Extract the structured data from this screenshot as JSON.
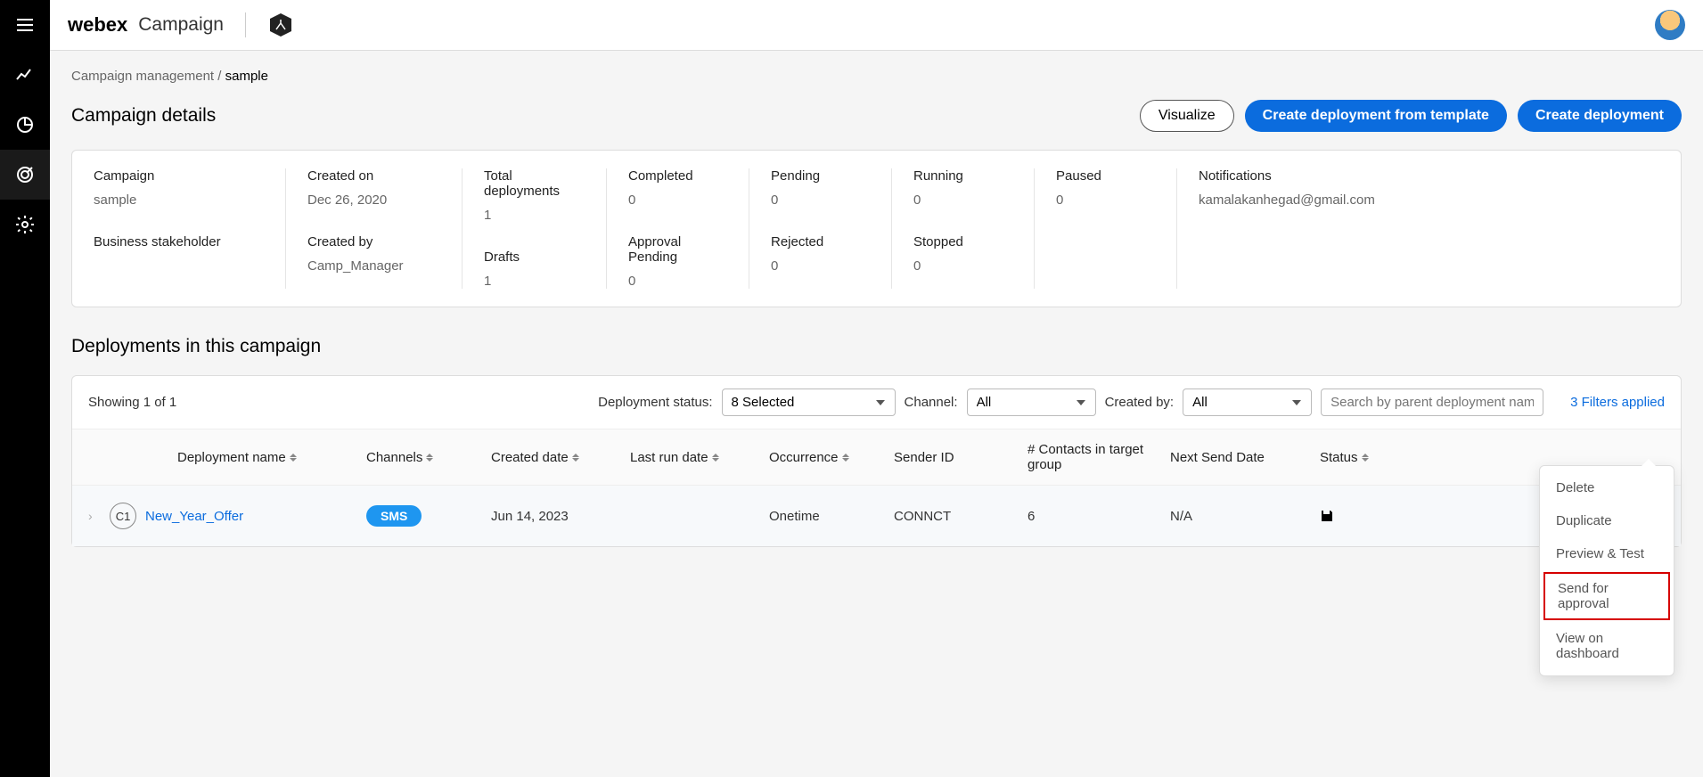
{
  "app": {
    "brand": "webex",
    "product": "Campaign"
  },
  "breadcrumb": {
    "parent": "Campaign management",
    "sep": " / ",
    "current": "sample"
  },
  "page_title": "Campaign details",
  "actions": {
    "visualize": "Visualize",
    "create_from_template": "Create deployment from template",
    "create_deployment": "Create deployment"
  },
  "details": {
    "campaign_label": "Campaign",
    "campaign_value": "sample",
    "stakeholder_label": "Business stakeholder",
    "stakeholder_value": "",
    "created_on_label": "Created on",
    "created_on_value": "Dec 26, 2020",
    "created_by_label": "Created by",
    "created_by_value": "Camp_Manager",
    "total_label": "Total deployments",
    "total_value": "1",
    "drafts_label": "Drafts",
    "drafts_value": "1",
    "completed_label": "Completed",
    "completed_value": "0",
    "approval_label": "Approval Pending",
    "approval_value": "0",
    "pending_label": "Pending",
    "pending_value": "0",
    "rejected_label": "Rejected",
    "rejected_value": "0",
    "running_label": "Running",
    "running_value": "0",
    "stopped_label": "Stopped",
    "stopped_value": "0",
    "paused_label": "Paused",
    "paused_value": "0",
    "notifications_label": "Notifications",
    "notifications_value": "@gmail.com",
    "notifications_redacted": "kamalakanhegad"
  },
  "section_title": "Deployments in this campaign",
  "filters": {
    "showing": "Showing 1 of 1",
    "status_label": "Deployment status:",
    "status_value": "8 Selected",
    "channel_label": "Channel:",
    "channel_value": "All",
    "createdby_label": "Created by:",
    "createdby_value": "All",
    "search_placeholder": "Search by parent deployment name",
    "applied": "3 Filters applied"
  },
  "columns": {
    "name": "Deployment name",
    "channels": "Channels",
    "created": "Created date",
    "lastrun": "Last run date",
    "occurrence": "Occurrence",
    "sender": "Sender ID",
    "contacts": "# Contacts in target group",
    "next": "Next Send Date",
    "status": "Status"
  },
  "rows": [
    {
      "badge": "C1",
      "name": "New_Year_Offer",
      "channel": "SMS",
      "created": "Jun 14, 2023",
      "lastrun": "",
      "occurrence": "Onetime",
      "sender": "CONNCT",
      "contacts": "6",
      "next": "N/A"
    }
  ],
  "menu": {
    "delete": "Delete",
    "duplicate": "Duplicate",
    "preview": "Preview & Test",
    "send_approval": "Send for approval",
    "view_dashboard": "View on dashboard"
  }
}
